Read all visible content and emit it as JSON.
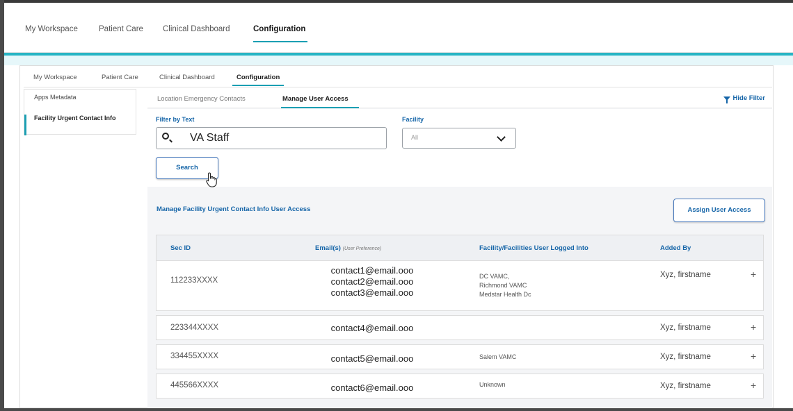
{
  "outer_nav": {
    "tabs": [
      "My Workspace",
      "Patient Care",
      "Clinical Dashboard",
      "Configuration"
    ],
    "active": "Configuration"
  },
  "inner_nav": {
    "tabs": [
      "My Workspace",
      "Patient Care",
      "Clinical Dashboard",
      "Configuration"
    ],
    "active": "Configuration"
  },
  "sidebar": {
    "items": [
      "Apps Metadata",
      "Facility Urgent Contact Info"
    ],
    "selected": "Facility Urgent Contact Info"
  },
  "subtabs": {
    "tabs": [
      "Location Emergency Contacts",
      "Manage User Access"
    ],
    "active": "Manage User Access",
    "hide_filter": "Hide Filter"
  },
  "filter": {
    "text_label": "Filter by Text",
    "text_value": "VA Staff",
    "facility_label": "Facility",
    "facility_value": "All",
    "search_button": "Search"
  },
  "section": {
    "title": "Manage Facility Urgent Contact Info User Access",
    "assign_button": "Assign User Access"
  },
  "table": {
    "columns": {
      "sec_id": "Sec ID",
      "email": "Email(s)",
      "email_note": "(User Preference)",
      "facility": "Facility/Facilities User Logged Into",
      "added_by": "Added By"
    },
    "rows": [
      {
        "sec_id": "112233XXXX",
        "emails": [
          "contact1@email.ooo",
          "contact2@email.ooo",
          "contact3@email.ooo"
        ],
        "facilities": [
          "DC VAMC,",
          "Richmond VAMC",
          "Medstar Health Dc"
        ],
        "added_by": "Xyz, firstname",
        "action": "+"
      },
      {
        "sec_id": "223344XXXX",
        "emails": [
          "contact4@email.ooo"
        ],
        "facilities": [],
        "added_by": "Xyz, firstname",
        "action": "+"
      },
      {
        "sec_id": "334455XXXX",
        "emails": [
          "contact5@email.ooo"
        ],
        "facilities": [
          "Salem VAMC"
        ],
        "added_by": "Xyz, firstname",
        "action": "+"
      },
      {
        "sec_id": "445566XXXX",
        "emails": [
          "contact6@email.ooo"
        ],
        "facilities": [
          "Unknown"
        ],
        "added_by": "Xyz, firstname",
        "action": "+"
      }
    ]
  },
  "colors": {
    "accent_teal": "#27b4c4",
    "link_blue": "#1565a8",
    "content_bg": "#f4f5f7"
  }
}
